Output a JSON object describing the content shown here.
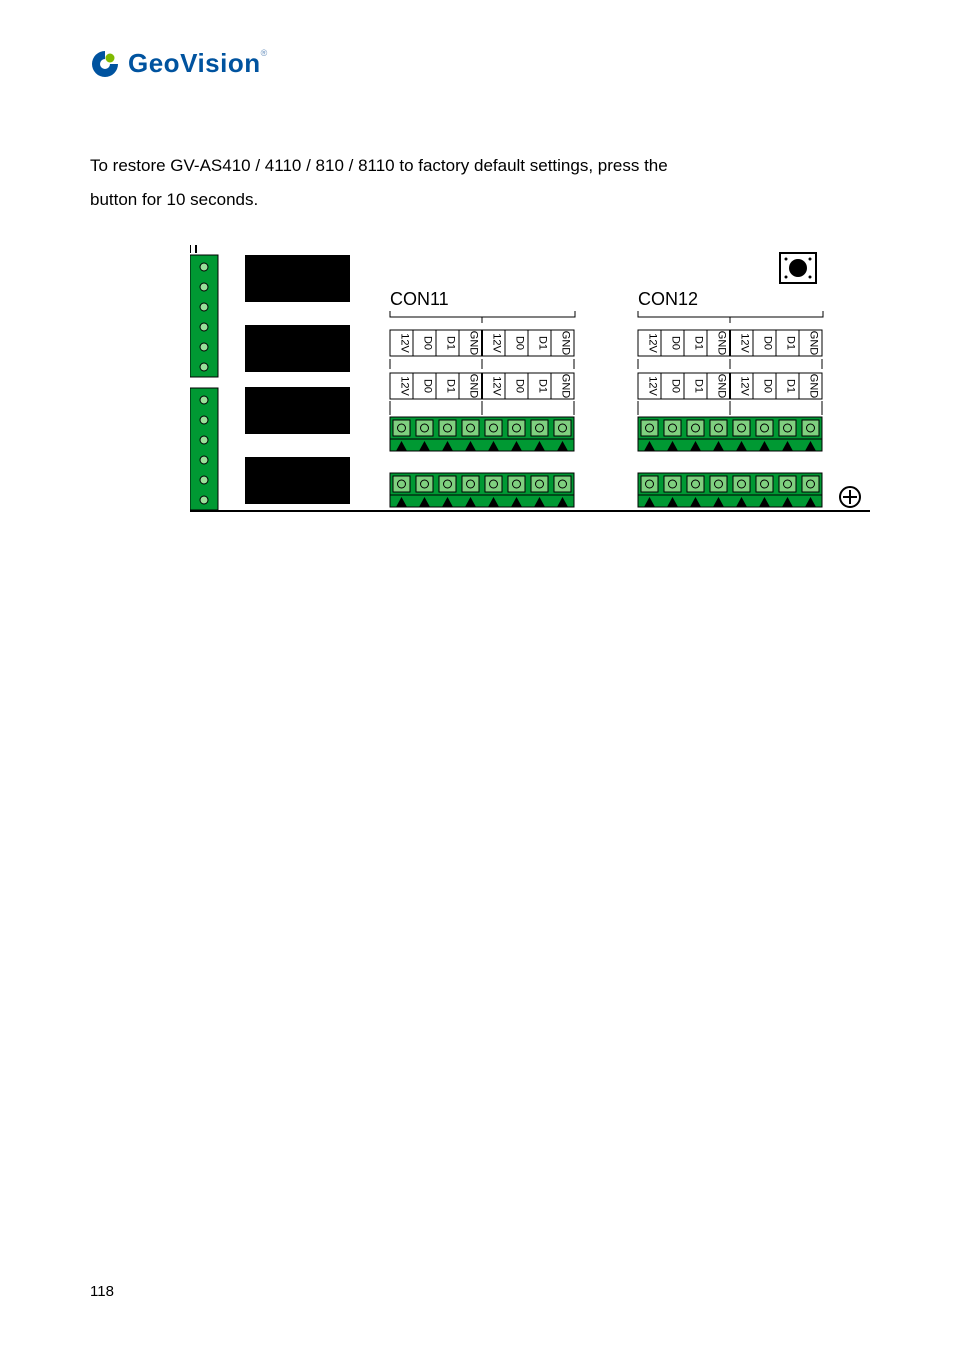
{
  "logo": {
    "text": "GeoVision",
    "tm": "®"
  },
  "body": {
    "line1": "To restore GV-AS410 / 4110 / 810 / 8110 to factory default settings, press the",
    "line2": "button for 10 seconds."
  },
  "diagram": {
    "con11": "CON11",
    "con12": "CON12",
    "pins": [
      "12V",
      "D0",
      "D1",
      "GND"
    ]
  },
  "page": "118"
}
